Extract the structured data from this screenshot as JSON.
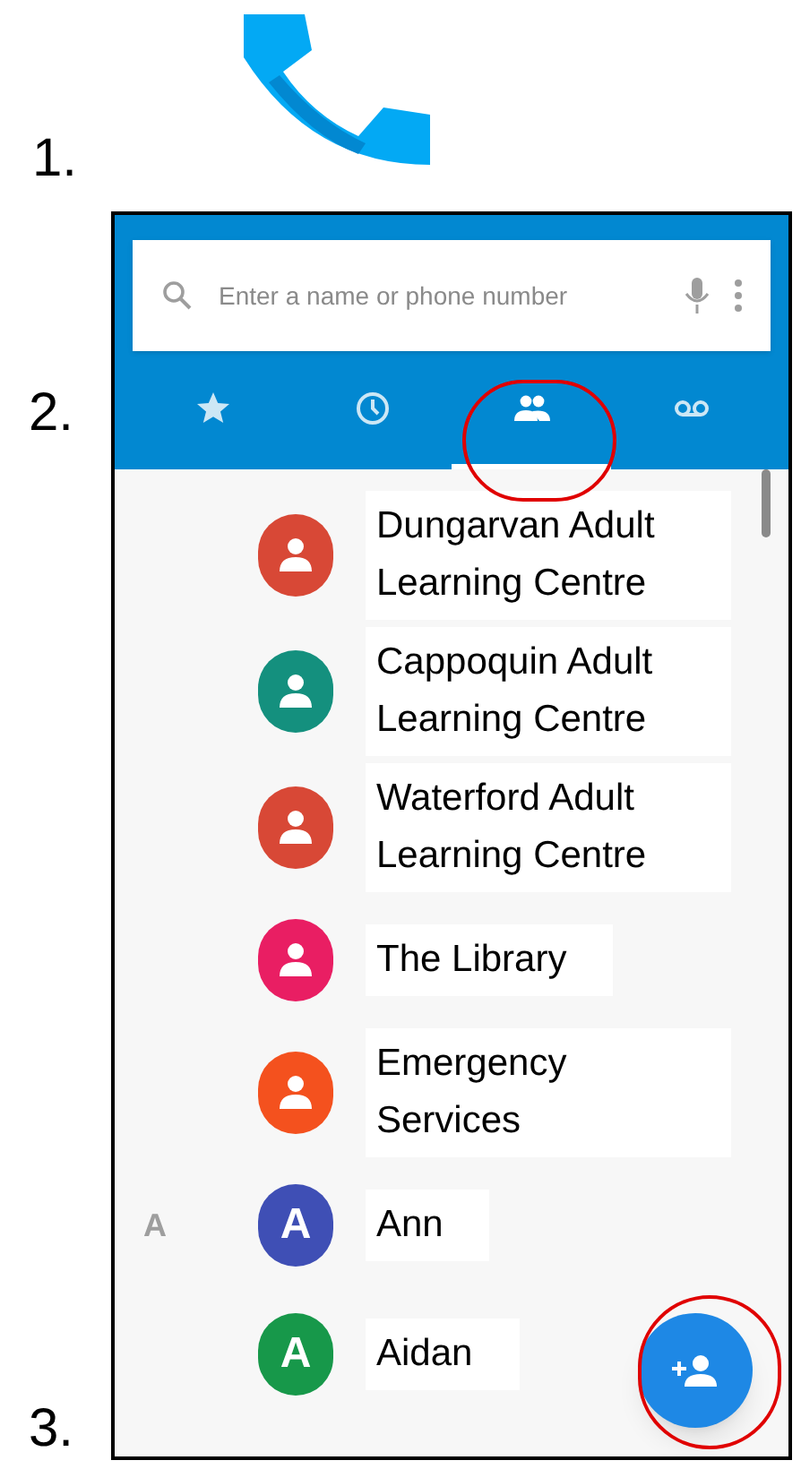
{
  "steps": [
    "1.",
    "2.",
    "3."
  ],
  "search": {
    "placeholder": "Enter a name or phone number"
  },
  "tabs": [
    {
      "kind": "favorites",
      "selected": false
    },
    {
      "kind": "recents",
      "selected": false
    },
    {
      "kind": "contacts",
      "selected": true
    },
    {
      "kind": "voicemail",
      "selected": false
    }
  ],
  "contacts": [
    {
      "name": "Dungarvan Adult Learning Centre",
      "kind": "person",
      "color": "#d84836"
    },
    {
      "name": "Cappoquin Adult Learning Centre",
      "kind": "person",
      "color": "#14907e"
    },
    {
      "name": "Waterford Adult Learning Centre",
      "kind": "person",
      "color": "#d84836"
    },
    {
      "name": "The Library",
      "kind": "person",
      "color": "#e91e63"
    },
    {
      "name": "Emergency Services",
      "kind": "person",
      "color": "#f4511e"
    },
    {
      "name": "Ann",
      "kind": "letter",
      "letter": "A",
      "section": "A",
      "color": "#3f4fb5"
    },
    {
      "name": "Aidan",
      "kind": "letter",
      "letter": "A",
      "color": "#17984a"
    }
  ]
}
